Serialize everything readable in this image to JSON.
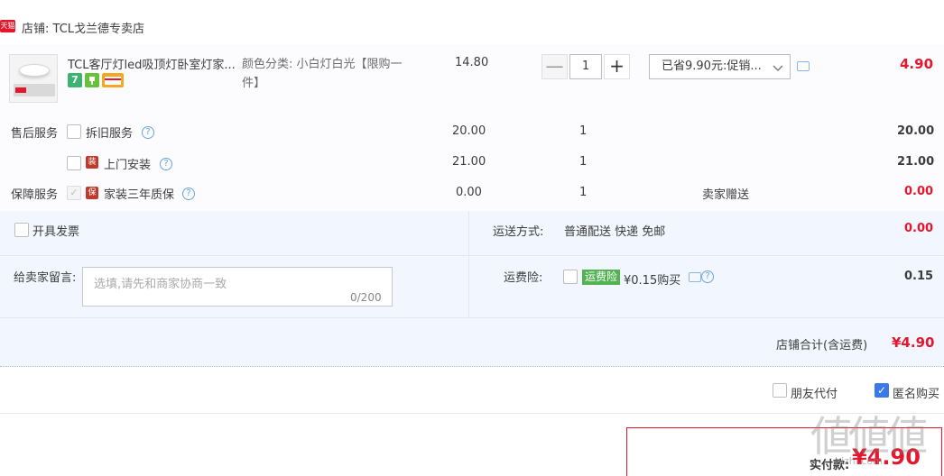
{
  "shop": {
    "badge": "天猫",
    "name": "店铺: TCL戈兰德专卖店"
  },
  "product": {
    "title": "TCL客厅灯led吸顶灯卧室灯家...",
    "badge_7": "7",
    "sku": "颜色分类: 小白灯白光【限购一件】",
    "unit_price": "14.80",
    "quantity": "1",
    "qty_minus": "—",
    "qty_plus": "+",
    "promo": "已省9.90元:促销...",
    "subtotal": "4.90"
  },
  "services": {
    "after_sale_label": "售后服务",
    "items": [
      {
        "name": "拆旧服务",
        "price": "20.00",
        "qty": "1",
        "subtotal": "20.00"
      },
      {
        "name": "上门安装",
        "price": "21.00",
        "qty": "1",
        "subtotal": "21.00"
      }
    ],
    "guarantee_label": "保障服务",
    "guarantee": {
      "icon": "保",
      "name": "家装三年质保",
      "price": "0.00",
      "qty": "1",
      "note": "卖家赠送",
      "subtotal": "0.00"
    }
  },
  "invoice": {
    "label": "开具发票"
  },
  "shipping": {
    "label": "运送方式:",
    "method": "普通配送 快递 免邮",
    "fee": "0.00"
  },
  "message": {
    "label": "给卖家留言:",
    "placeholder": "选填,请先和商家协商一致",
    "count": "0/200"
  },
  "insurance": {
    "label": "运费险:",
    "badge": "运费险",
    "text": "¥0.15购买",
    "fee": "0.15"
  },
  "shop_total": {
    "label": "店铺合计(含运费)",
    "value": "¥4.90"
  },
  "options": {
    "friend_pay": "朋友代付",
    "anonymous": "匿名购买"
  },
  "payment": {
    "label": "实付款:",
    "value": "¥4.90"
  },
  "watermark": {
    "big": "値値値",
    "small": "hizhi.com"
  }
}
